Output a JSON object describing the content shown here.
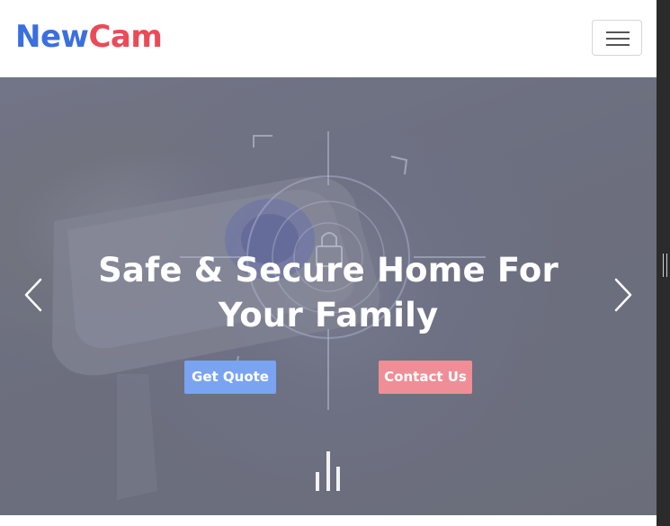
{
  "brand": {
    "part1": "New",
    "part2": "Cam"
  },
  "navbar": {
    "toggle_icon": "hamburger-menu-icon"
  },
  "hero": {
    "headline_line1": "Safe & Secure Home For",
    "headline_line2": "Your Family",
    "primary_button": "Get Quote",
    "secondary_button": "Contact Us",
    "prev_icon": "chevron-left-icon",
    "next_icon": "chevron-right-icon",
    "indicator_icon": "slide-indicator-icon"
  },
  "colors": {
    "brand_blue": "#3b6fe0",
    "brand_red": "#ea4b57",
    "quote_button": "#7aa4f2",
    "contact_button": "#ef8e96",
    "hero_overlay": "#6e7182"
  }
}
